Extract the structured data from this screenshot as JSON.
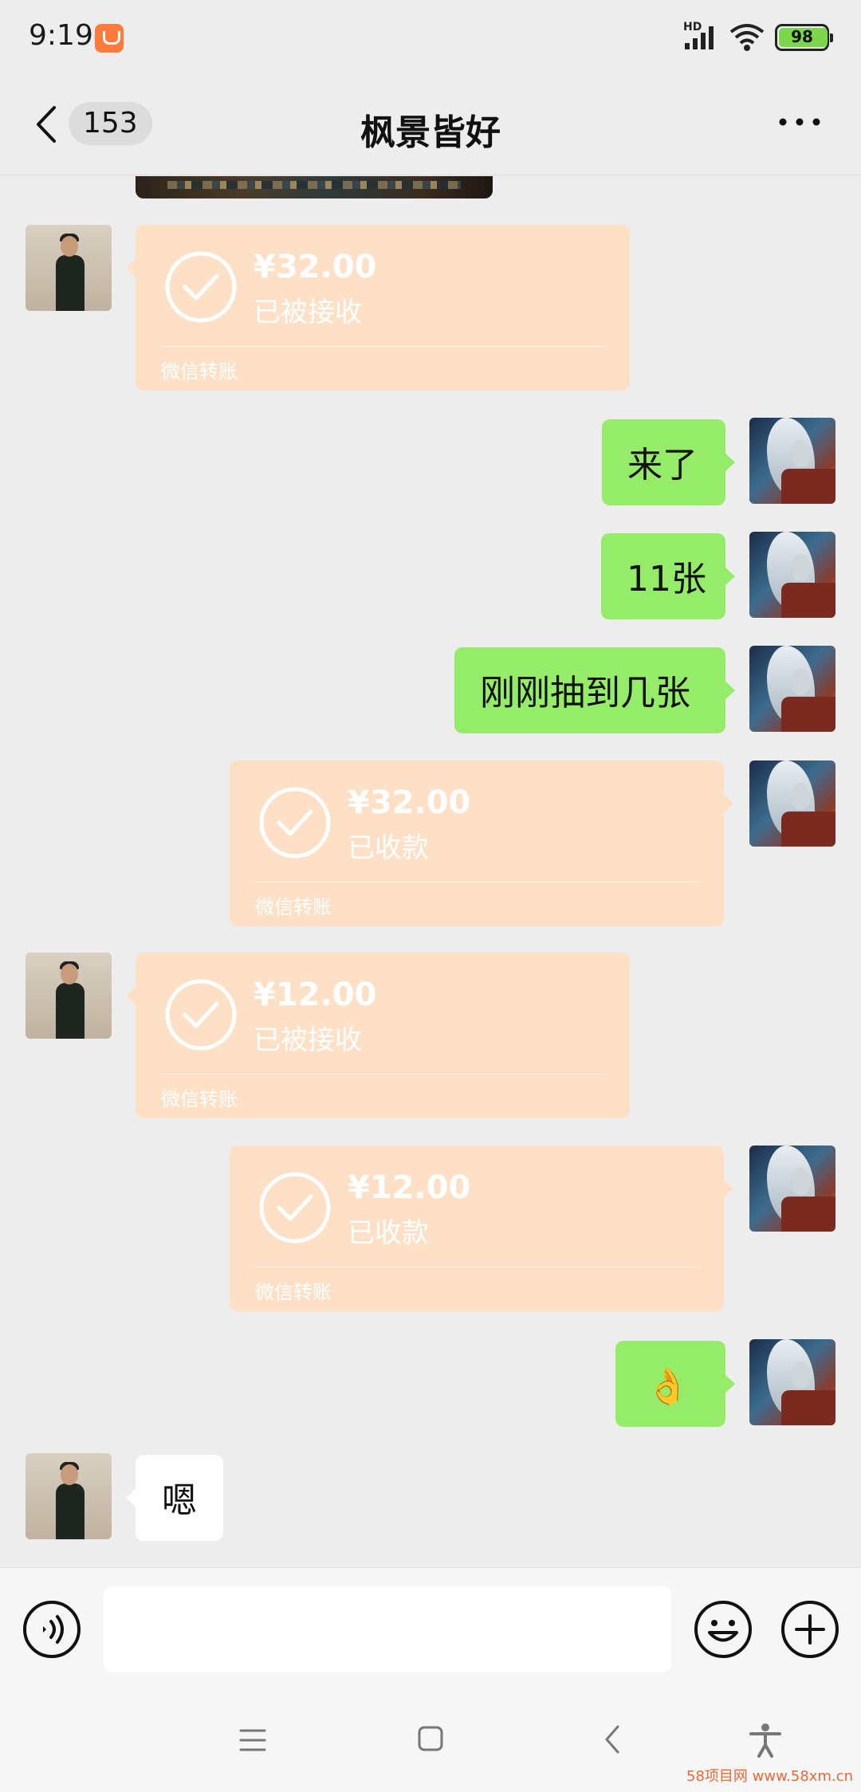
{
  "status_bar": {
    "time": "9:19",
    "network_label": "HD",
    "battery_level": "98",
    "battery_percent": 98
  },
  "header": {
    "unread_count": "153",
    "title": "枫景皆好",
    "more_icon": "more-horizontal-icon",
    "back_icon": "chevron-left-icon"
  },
  "messages": [
    {
      "side": "left",
      "type": "transfer",
      "amount": "¥32.00",
      "status": "已被接收",
      "label": "微信转账"
    },
    {
      "side": "right",
      "type": "text",
      "text": "来了"
    },
    {
      "side": "right",
      "type": "text",
      "text": "11张"
    },
    {
      "side": "right",
      "type": "text",
      "text": "刚刚抽到几张"
    },
    {
      "side": "right",
      "type": "transfer",
      "amount": "¥32.00",
      "status": "已收款",
      "label": "微信转账"
    },
    {
      "side": "left",
      "type": "transfer",
      "amount": "¥12.00",
      "status": "已被接收",
      "label": "微信转账"
    },
    {
      "side": "right",
      "type": "transfer",
      "amount": "¥12.00",
      "status": "已收款",
      "label": "微信转账"
    },
    {
      "side": "right",
      "type": "text",
      "text": "👌"
    },
    {
      "side": "left",
      "type": "text",
      "text": "嗯"
    }
  ],
  "input_bar": {
    "placeholder": "",
    "voice_icon": "voice-icon",
    "emoji_icon": "emoji-icon",
    "plus_icon": "plus-circle-icon"
  },
  "nav_bar": {
    "icons": [
      "menu-icon",
      "home-square-icon",
      "back-icon",
      "accessibility-icon"
    ]
  },
  "watermark": "58项目网 www.58xm.cn",
  "colors": {
    "background": "#ededed",
    "sent_bubble": "#95ec69",
    "received_bubble": "#ffffff",
    "transfer_done": "#fde0c5",
    "app_notification": "#ff7a3d",
    "battery": "#7bd64a"
  }
}
